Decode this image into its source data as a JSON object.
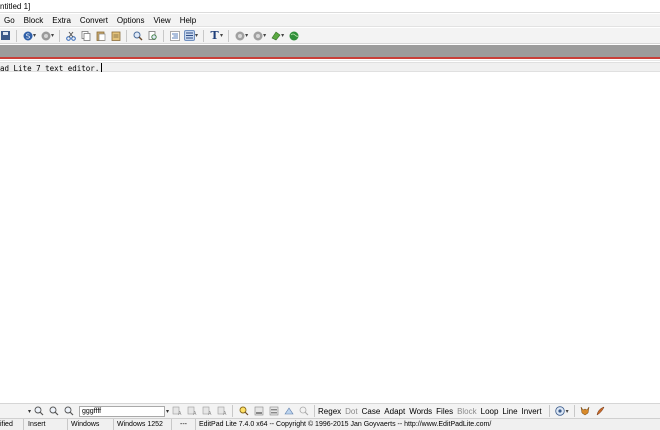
{
  "window": {
    "title": "ntitled 1]"
  },
  "menu": {
    "items": [
      "Go",
      "Block",
      "Extra",
      "Convert",
      "Options",
      "View",
      "Help"
    ]
  },
  "toolbar": {
    "buttons": [
      "save-icon",
      "spellcheck-icon",
      "circle-icon",
      "scissors-icon",
      "copy-icon",
      "paste-icon",
      "clipboard-icon",
      "find-icon",
      "replace-icon",
      "indent-icon",
      "wrap-icon",
      "font-icon",
      "record-icon",
      "play-icon",
      "tools-icon",
      "globe-icon"
    ],
    "font_glyph": "T"
  },
  "editor": {
    "text": "ad Lite 7 text editor."
  },
  "searchbar": {
    "search_value": "gggffff",
    "options": [
      {
        "label": "Regex",
        "hot": "R",
        "enabled": true
      },
      {
        "label": "Dot",
        "hot": "D",
        "enabled": false
      },
      {
        "label": "Case",
        "hot": "C",
        "enabled": true
      },
      {
        "label": "Adapt",
        "hot": "A",
        "enabled": true
      },
      {
        "label": "Words",
        "hot": "W",
        "enabled": true
      },
      {
        "label": "Files",
        "hot": "F",
        "enabled": true
      },
      {
        "label": "Block",
        "hot": "B",
        "enabled": false
      },
      {
        "label": "Loop",
        "hot": "L",
        "enabled": true
      },
      {
        "label": "Line",
        "hot": "n",
        "enabled": true
      },
      {
        "label": "Invert",
        "hot": "I",
        "enabled": true
      }
    ]
  },
  "statusbar": {
    "modified": "ified",
    "mode": "Insert",
    "line_break": "Windows",
    "encoding": "Windows 1252",
    "extra": "---",
    "about": "EditPad Lite 7.4.0 x64  --  Copyright © 1996-2015  Jan Goyvaerts  --  http://www.EditPadLite.com/"
  },
  "colors": {
    "tab_strip": "#9c9c9c",
    "accent_line": "#c9403a"
  }
}
